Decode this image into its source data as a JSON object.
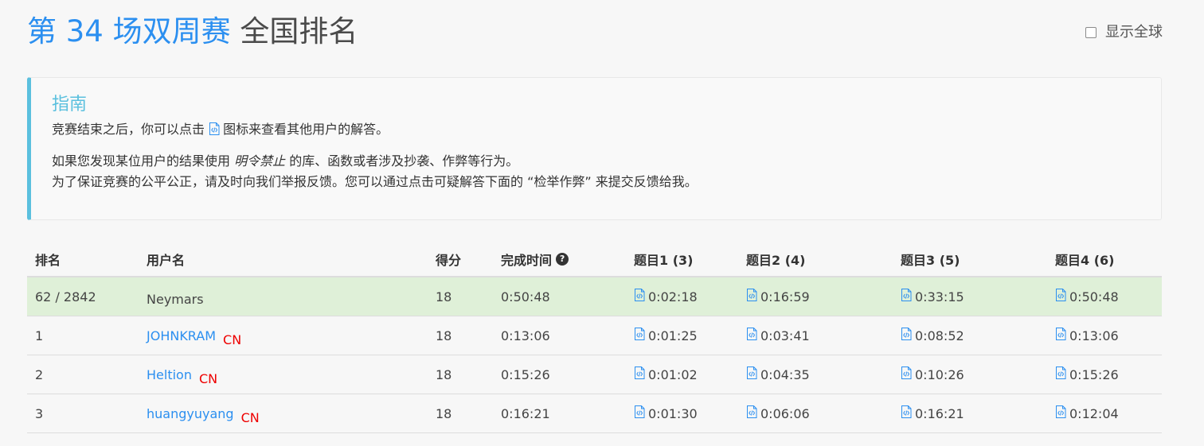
{
  "title": {
    "contest": "第 34 场双周赛",
    "rank": "全国排名"
  },
  "global_toggle": {
    "label": "显示全球",
    "checked": false
  },
  "guide": {
    "title": "指南",
    "line1_before": "竞赛结束之后，你可以点击",
    "line1_after": "图标来查看其他用户的解答。",
    "line2_before": "如果您发现某位用户的结果使用",
    "line2_emph": "明令禁止",
    "line2_after": "的库、函数或者涉及抄袭、作弊等行为。",
    "line3": "为了保证竞赛的公平公正，请及时向我们举报反馈。您可以通过点击可疑解答下面的 “检举作弊” 来提交反馈给我。"
  },
  "table": {
    "headers": {
      "rank": "排名",
      "user": "用户名",
      "score": "得分",
      "time": "完成时间",
      "q1": "题目1 (3)",
      "q2": "题目2 (4)",
      "q3": "题目3 (5)",
      "q4": "题目4 (6)"
    },
    "self_row": {
      "rank": "62 / 2842",
      "user": "Neymars",
      "score": "18",
      "time": "0:50:48",
      "q1": "0:02:18",
      "q2": "0:16:59",
      "q3": "0:33:15",
      "q4": "0:50:48"
    },
    "rows": [
      {
        "rank": "1",
        "user": "JOHNKRAM",
        "region": "CN",
        "score": "18",
        "time": "0:13:06",
        "q1": "0:01:25",
        "q2": "0:03:41",
        "q3": "0:08:52",
        "q4": "0:13:06"
      },
      {
        "rank": "2",
        "user": "Heltion",
        "region": "CN",
        "score": "18",
        "time": "0:15:26",
        "q1": "0:01:02",
        "q2": "0:04:35",
        "q3": "0:10:26",
        "q4": "0:15:26"
      },
      {
        "rank": "3",
        "user": "huangyuyang",
        "region": "CN",
        "score": "18",
        "time": "0:16:21",
        "q1": "0:01:30",
        "q2": "0:06:06",
        "q3": "0:16:21",
        "q4": "0:12:04"
      }
    ]
  },
  "colors": {
    "accent": "#2b8ff0",
    "guide_border": "#5bc0de",
    "highlight_row": "#dff0d8",
    "region": "#ee0000"
  },
  "icons": {
    "solution": "code-file-icon",
    "help": "question-circle-icon"
  }
}
